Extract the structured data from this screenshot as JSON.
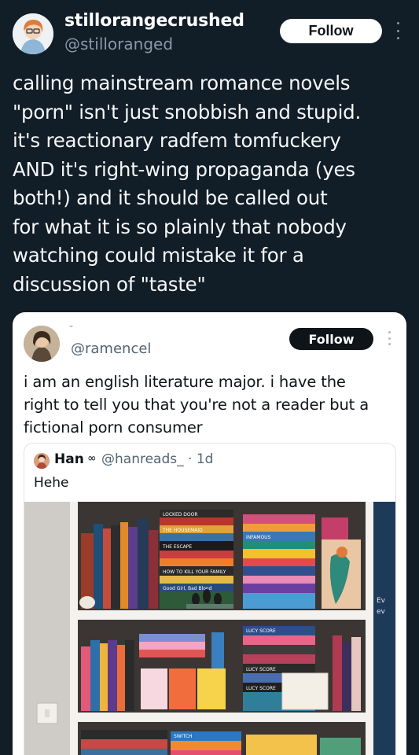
{
  "post": {
    "display_name": "stillorangecrushed",
    "handle": "@stilloranged",
    "follow_label": "Follow",
    "text": "calling mainstream romance novels\n\"porn\" isn't just snobbish and stupid.\nit's reactionary radfem tomfuckery\nAND it's right-wing propaganda (yes\nboth!) and it should be called out\nfor what it is so plainly that nobody\nwatching could mistake it for a\ndiscussion of \"taste\""
  },
  "quote": {
    "dash": "-",
    "handle": "@ramencel",
    "follow_label": "Follow",
    "text": "i am an english literature major. i have the\nright to tell you that you're not a reader but a\nfictional porn consumer"
  },
  "inner_quote": {
    "name": "Han",
    "badge": "∞",
    "handle_meta": "@hanreads_ · 1d",
    "text": "Hehe"
  },
  "photo_book_labels": {
    "top_stack": [
      "LOCKED DOOR",
      "THE HOUSEMAID",
      "THE ESCAPE",
      "HOW TO KILL YOUR FAMILY",
      "Good Girl, Bad Blood"
    ],
    "right_stack": [
      "INFAMOUS",
      "LUCY SCORE",
      "LUCY SCORE",
      "LUCY SCORE"
    ],
    "lower": [
      "SWITCH"
    ]
  },
  "colors": {
    "background": "#111d27",
    "follow_light": "#ffffff",
    "follow_dark": "#0f1419",
    "handle_gray": "#8b98a5"
  }
}
